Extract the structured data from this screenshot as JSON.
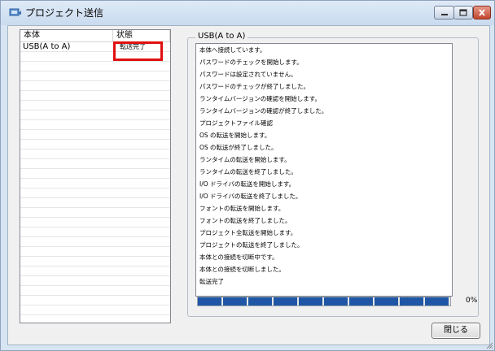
{
  "window": {
    "title": "プロジェクト送信"
  },
  "colors": {
    "progress_fill": "#1f57a6",
    "highlight_border": "#e01010"
  },
  "list": {
    "columns": [
      "本体",
      "状態"
    ],
    "rows": [
      {
        "device": "USB(A to A)",
        "status": "転送完了"
      }
    ]
  },
  "log": {
    "legend": "USB(A to A)",
    "lines": [
      "本体へ接続しています。",
      "パスワードのチェックを開始します。",
      "パスワードは設定されていません。",
      "パスワードのチェックが終了しました。",
      "ランタイムバージョンの確認を開始します。",
      "ランタイムバージョンの確認が終了しました。",
      "プロジェクトファイル確認",
      "OS の転送を開始します。",
      "OS の転送が終了しました。",
      "ランタイムの転送を開始します。",
      "ランタイムの転送を終了しました。",
      "I/O ドライバの転送を開始します。",
      "I/O ドライバの転送を終了しました。",
      "フォントの転送を開始します。",
      "フォントの転送を終了しました。",
      "プロジェクト全転送を開始します。",
      "プロジェクトの転送を終了しました。",
      "本体との接続を切断中です。",
      "本体との接続を切断しました。",
      "転送完了"
    ]
  },
  "progress": {
    "value": 100,
    "label": "0%"
  },
  "buttons": {
    "close": "閉じる"
  },
  "icons": {
    "app": "window-app-icon",
    "minimize": "minimize-icon",
    "maximize": "maximize-icon",
    "close": "close-icon"
  }
}
